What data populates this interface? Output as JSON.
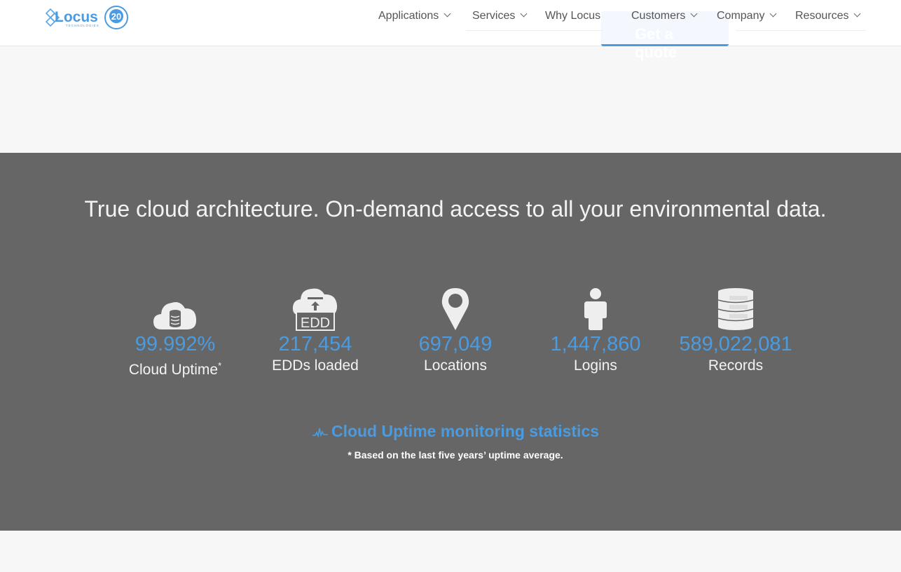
{
  "header": {
    "logo": {
      "name": "Locus",
      "sub": "TECHNOLOGIES",
      "badge": "20"
    },
    "nav": [
      {
        "label": "Applications",
        "has_dropdown": true
      },
      {
        "label": "Services",
        "has_dropdown": true
      },
      {
        "label": "Why Locus",
        "has_dropdown": false
      },
      {
        "label": "Customers",
        "has_dropdown": true
      },
      {
        "label": "Company",
        "has_dropdown": true
      },
      {
        "label": "Resources",
        "has_dropdown": true
      }
    ],
    "cta": {
      "label": "Get a quote",
      "icon": "chevron-right-icon"
    }
  },
  "stats_section": {
    "headline": "True cloud architecture. On-demand access to all your environmental data.",
    "stats": [
      {
        "icon": "cloud-database-icon",
        "value": "99.992%",
        "label": "Cloud Uptime",
        "footnote_mark": "*"
      },
      {
        "icon": "cloud-upload-edd-icon",
        "value": "217,454",
        "label": "EDDs loaded",
        "icon_text": "EDD"
      },
      {
        "icon": "map-pin-icon",
        "value": "697,049",
        "label": "Locations"
      },
      {
        "icon": "person-icon",
        "value": "1,447,860",
        "label": "Logins"
      },
      {
        "icon": "database-icon",
        "value": "589,022,081",
        "label": "Records"
      }
    ],
    "monitoring_link": {
      "label": "Cloud Uptime monitoring statistics",
      "icon": "pulse-icon"
    },
    "footnote": "* Based on the last five years’ uptime average."
  },
  "colors": {
    "accent": "#4a9be0",
    "band": "#666666",
    "page_bg": "#f7f7f7"
  }
}
